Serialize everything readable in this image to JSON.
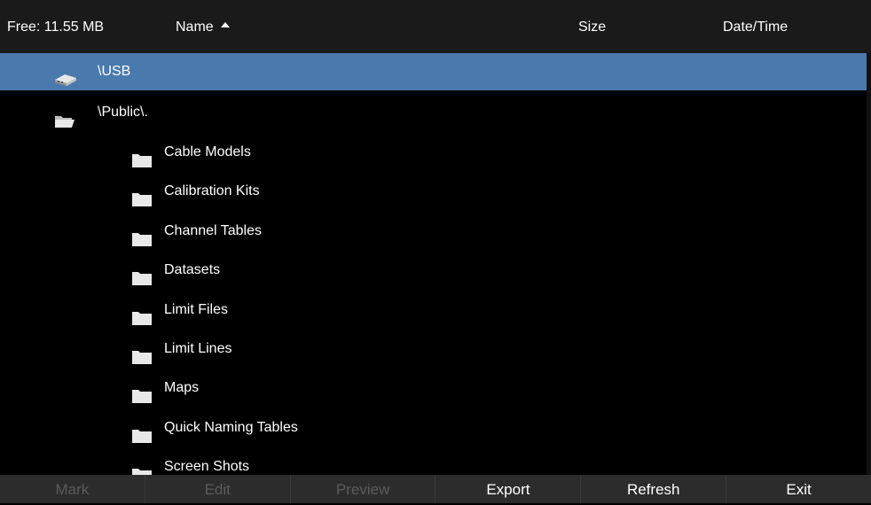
{
  "header": {
    "free": "Free: 11.55 MB",
    "name": "Name",
    "size": "Size",
    "datetime": "Date/Time",
    "sort_icon": "sort-ascending-icon"
  },
  "rows": [
    {
      "label": "\\USB",
      "icon": "usb-drive-icon",
      "selected": true
    },
    {
      "label": "\\Public\\.",
      "icon": "open-folder-icon",
      "selected": false
    },
    {
      "label": "Cable Models",
      "icon": "folder-icon",
      "selected": false
    },
    {
      "label": "Calibration Kits",
      "icon": "folder-icon",
      "selected": false
    },
    {
      "label": "Channel Tables",
      "icon": "folder-icon",
      "selected": false
    },
    {
      "label": "Datasets",
      "icon": "folder-icon",
      "selected": false
    },
    {
      "label": "Limit Files",
      "icon": "folder-icon",
      "selected": false
    },
    {
      "label": "Limit Lines",
      "icon": "folder-icon",
      "selected": false
    },
    {
      "label": "Maps",
      "icon": "folder-icon",
      "selected": false
    },
    {
      "label": "Quick Naming Tables",
      "icon": "folder-icon",
      "selected": false
    },
    {
      "label": "Screen Shots",
      "icon": "folder-icon",
      "selected": false
    }
  ],
  "footer": {
    "mark": "Mark",
    "edit": "Edit",
    "preview": "Preview",
    "export": "Export",
    "refresh": "Refresh",
    "exit": "Exit"
  },
  "colors": {
    "selection": "#4a79ad",
    "background": "#000000",
    "header": "#1a1a1a",
    "footer": "#2c2c2c",
    "disabled_text": "#5c5c5c"
  }
}
